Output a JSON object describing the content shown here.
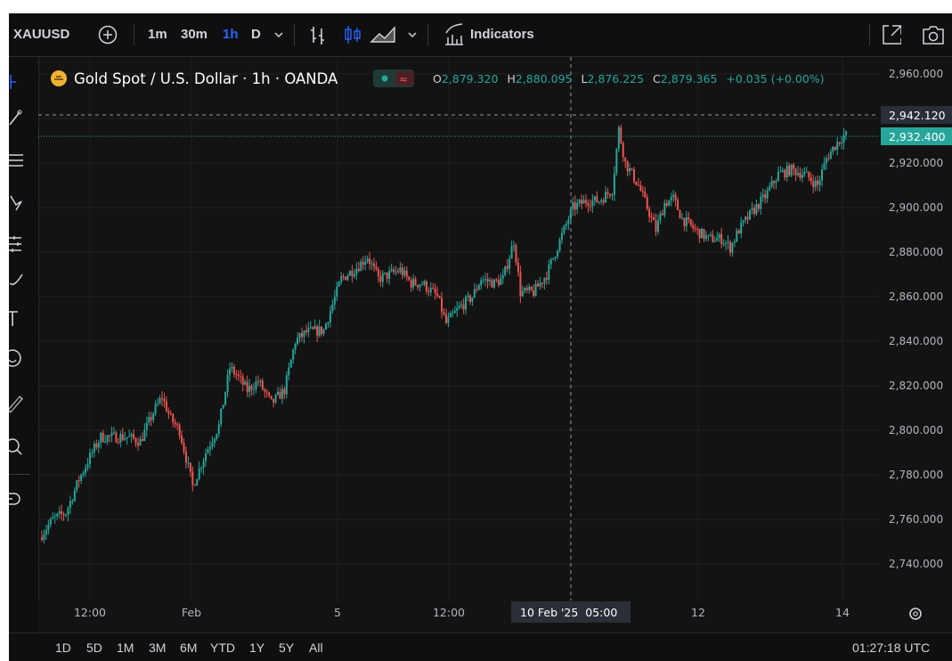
{
  "toolbar": {
    "symbol": "XAUUSD",
    "intervals": [
      "1m",
      "30m",
      "1h",
      "D"
    ],
    "active_interval": "1h",
    "indicators_label": "Indicators"
  },
  "legend": {
    "title": "Gold Spot / U.S. Dollar · 1h · OANDA",
    "o_label": "O",
    "o_value": "2,879.320",
    "h_label": "H",
    "h_value": "2,880.095",
    "l_label": "L",
    "l_value": "2,876.225",
    "c_label": "C",
    "c_value": "2,879.365",
    "change": "+0.035 (+0.00%)"
  },
  "price_axis": {
    "crosshair_price": "2,942.120",
    "last_price": "2,932.400"
  },
  "time_axis": {
    "crosshair_label": "10 Feb '25  05:00"
  },
  "bottom": {
    "ranges": [
      "1D",
      "5D",
      "1M",
      "3M",
      "6M",
      "YTD",
      "1Y",
      "5Y",
      "All"
    ],
    "clock": "01:27:18 UTC"
  },
  "colors": {
    "up": "#26a69a",
    "down": "#ef5350",
    "background": "#131313",
    "active_interval": "#2962ff"
  },
  "chart_data": {
    "type": "candlestick",
    "y_ticks": [
      "2,960.000",
      "2,940.000",
      "2,920.000",
      "2,900.000",
      "2,880.000",
      "2,860.000",
      "2,840.000",
      "2,820.000",
      "2,800.000",
      "2,780.000",
      "2,760.000",
      "2,740.000"
    ],
    "y_range": [
      2735,
      2963
    ],
    "x_ticks": [
      "12:00",
      "Feb",
      "5",
      "12:00",
      "12",
      "14"
    ],
    "crosshair_price": 2942.12,
    "last_price": 2932.4,
    "anchors": [
      [
        0,
        2752
      ],
      [
        6,
        2760
      ],
      [
        12,
        2763
      ],
      [
        18,
        2778
      ],
      [
        24,
        2790
      ],
      [
        28,
        2797
      ],
      [
        34,
        2797
      ],
      [
        40,
        2797
      ],
      [
        46,
        2795
      ],
      [
        52,
        2808
      ],
      [
        56,
        2815
      ],
      [
        60,
        2805
      ],
      [
        64,
        2800
      ],
      [
        70,
        2775
      ],
      [
        76,
        2790
      ],
      [
        82,
        2802
      ],
      [
        87,
        2828
      ],
      [
        90,
        2825
      ],
      [
        95,
        2818
      ],
      [
        100,
        2822
      ],
      [
        106,
        2812
      ],
      [
        112,
        2818
      ],
      [
        117,
        2840
      ],
      [
        122,
        2844
      ],
      [
        130,
        2845
      ],
      [
        138,
        2868
      ],
      [
        145,
        2873
      ],
      [
        150,
        2878
      ],
      [
        155,
        2868
      ],
      [
        160,
        2870
      ],
      [
        165,
        2872
      ],
      [
        170,
        2866
      ],
      [
        175,
        2866
      ],
      [
        182,
        2860
      ],
      [
        186,
        2848
      ],
      [
        192,
        2855
      ],
      [
        198,
        2860
      ],
      [
        202,
        2868
      ],
      [
        208,
        2866
      ],
      [
        212,
        2868
      ],
      [
        217,
        2885
      ],
      [
        220,
        2862
      ],
      [
        226,
        2862
      ],
      [
        232,
        2870
      ],
      [
        238,
        2885
      ],
      [
        244,
        2900
      ],
      [
        250,
        2903
      ],
      [
        256,
        2903
      ],
      [
        262,
        2908
      ],
      [
        265,
        2935
      ],
      [
        268,
        2920
      ],
      [
        274,
        2910
      ],
      [
        278,
        2900
      ],
      [
        282,
        2890
      ],
      [
        286,
        2902
      ],
      [
        290,
        2904
      ],
      [
        294,
        2895
      ],
      [
        300,
        2890
      ],
      [
        306,
        2886
      ],
      [
        312,
        2886
      ],
      [
        316,
        2882
      ],
      [
        320,
        2890
      ],
      [
        326,
        2898
      ],
      [
        332,
        2905
      ],
      [
        338,
        2915
      ],
      [
        344,
        2917
      ],
      [
        350,
        2915
      ],
      [
        356,
        2910
      ],
      [
        360,
        2922
      ],
      [
        364,
        2928
      ],
      [
        368,
        2932.4
      ]
    ],
    "candle_count": 369
  }
}
